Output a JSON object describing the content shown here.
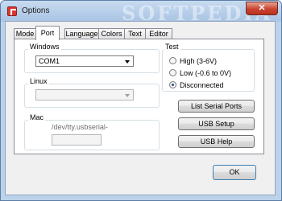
{
  "window": {
    "title": "Options",
    "watermark": "SOFTPEDIA",
    "close_glyph": "✕"
  },
  "tabs": [
    {
      "label": "Mode",
      "active": false
    },
    {
      "label": "Port",
      "active": true
    },
    {
      "label": "Language",
      "active": false
    },
    {
      "label": "Colors",
      "active": false
    },
    {
      "label": "Text",
      "active": false
    },
    {
      "label": "Editor",
      "active": false
    }
  ],
  "port": {
    "windows": {
      "label": "Windows",
      "selected": "COM1"
    },
    "linux": {
      "label": "Linux",
      "selected": ""
    },
    "mac": {
      "label": "Mac",
      "path": "/dev/tty.usbserial-",
      "value": ""
    },
    "test": {
      "label": "Test",
      "options": [
        {
          "label": "High (3-6V)",
          "checked": false
        },
        {
          "label": "Low (-0.6 to 0V)",
          "checked": false
        },
        {
          "label": "Disconnected",
          "checked": true
        }
      ]
    },
    "buttons": {
      "list_serial_ports": "List Serial Ports",
      "usb_setup": "USB Setup",
      "usb_help": "USB Help"
    }
  },
  "footer": {
    "ok_label": "OK"
  }
}
